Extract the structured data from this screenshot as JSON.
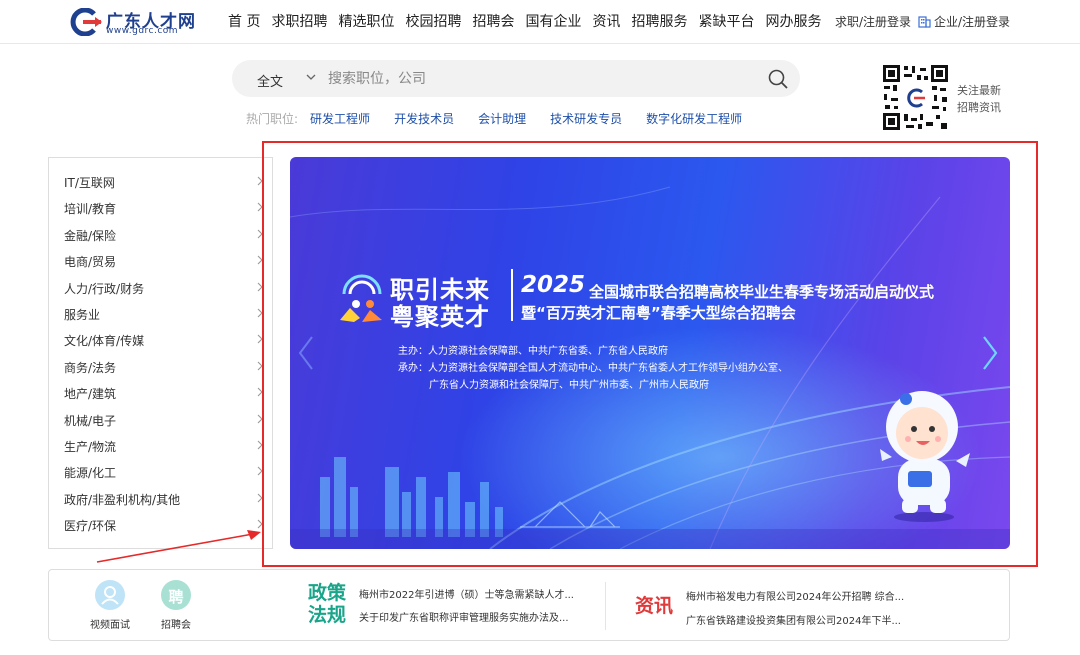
{
  "header": {
    "logo_name": "广东人才网",
    "logo_url": "www.gdrc.com",
    "nav": [
      "首 页",
      "求职招聘",
      "精选职位",
      "校园招聘",
      "招聘会",
      "国有企业",
      "资讯",
      "招聘服务",
      "紧缺平台",
      "网办服务"
    ],
    "login_user": "求职/注册登录",
    "login_company": "企业/注册登录"
  },
  "search": {
    "scope": "全文",
    "placeholder": "搜索职位，公司",
    "hot_label": "热门职位:",
    "hot_items": [
      "研发工程师",
      "开发技术员",
      "会计助理",
      "技术研发专员",
      "数字化研发工程师"
    ]
  },
  "qr": {
    "text_line1": "关注最新",
    "text_line2": "招聘资讯"
  },
  "sidebar": {
    "categories": [
      "IT/互联网",
      "培训/教育",
      "金融/保险",
      "电商/贸易",
      "人力/行政/财务",
      "服务业",
      "文化/体育/传媒",
      "商务/法务",
      "地产/建筑",
      "机械/电子",
      "生产/物流",
      "能源/化工",
      "政府/非盈利机构/其他",
      "医疗/环保"
    ]
  },
  "banner": {
    "logo_line1": "职引未来",
    "logo_line2": "粤聚英才",
    "year": "2025",
    "title1": "全国城市联合招聘高校毕业生春季专场活动启动仪式",
    "title2": "暨“百万英才汇南粤”春季大型综合招聘会",
    "org1": "主办：人力资源社会保障部、中共广东省委、广东省人民政府",
    "org2": "承办：人力资源社会保障部全国人才流动中心、中共广东省委人才工作领导小组办公室、",
    "org3": "广东省人力资源和社会保障厅、中共广州市委、广州市人民政府",
    "mascot_badge": "职引未来 粤聚英才"
  },
  "bottom": {
    "services": [
      {
        "label": "视频面试",
        "icon": "user-icon",
        "color": "#bfe3f7"
      },
      {
        "label": "招聘会",
        "icon": "hire-char-icon",
        "glyph": "聘",
        "color": "#a8e0d3"
      }
    ],
    "policy": {
      "title1": "政策",
      "title2": "法规",
      "color": "#1aa58a",
      "items": [
        "梅州市2022年引进博（硕）士等急需紧缺人才...",
        "关于印发广东省职称评审管理服务实施办法及..."
      ]
    },
    "news": {
      "title": "资讯",
      "color": "#e03a3a",
      "items": [
        "梅州市裕发电力有限公司2024年公开招聘 综合...",
        "广东省铁路建设投资集团有限公司2024年下半..."
      ]
    }
  },
  "colors": {
    "accent": "#1e4fa8",
    "highlight_frame": "#e52a2a"
  }
}
